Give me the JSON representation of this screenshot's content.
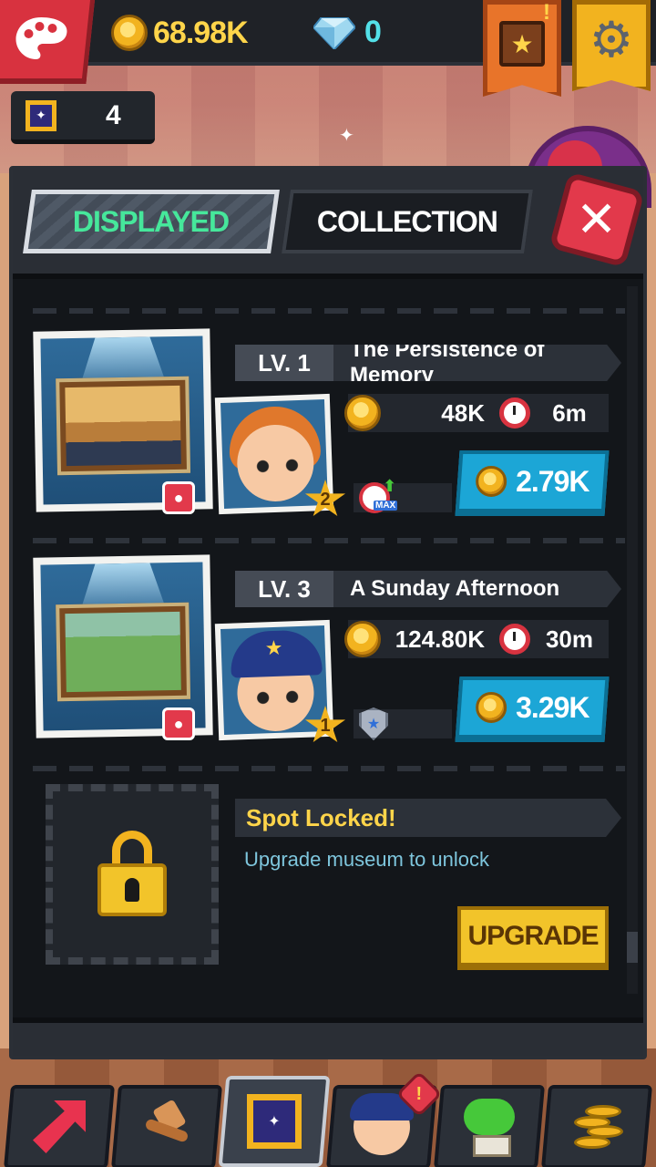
{
  "hud": {
    "coins": "68.98K",
    "gems": "0",
    "frames": "4",
    "icons": [
      "palette-icon",
      "coin-icon",
      "diamond-icon",
      "star-book-icon",
      "gear-icon",
      "frame-icon"
    ]
  },
  "tabs": {
    "displayed": "DISPLAYED",
    "collection": "COLLECTION",
    "active": "displayed"
  },
  "paintings": [
    {
      "level": "LV. 1",
      "name": "The Persistence of Memory",
      "income": "48K",
      "time": "6m",
      "worker_rank": "2",
      "speed_label": "MAX",
      "upgrade_cost": "2.79K"
    },
    {
      "level": "LV. 3",
      "name": "A Sunday Afternoon",
      "income": "124.80K",
      "time": "30m",
      "worker_rank": "1",
      "upgrade_cost": "3.29K"
    }
  ],
  "locked_slot": {
    "title": "Spot Locked!",
    "description": "Upgrade museum to unlock",
    "button": "UPGRADE"
  },
  "bottom_nav": {
    "items": [
      "arrow-icon",
      "hammer-icon",
      "frame-icon",
      "police-worker-icon",
      "tree-icon",
      "coins-icon"
    ],
    "active": 2,
    "alert": "!"
  },
  "colors": {
    "coin": "#f2b31f",
    "gem": "#53e0e8",
    "tab_active_text": "#46e79b",
    "upgrade_blue": "#1ca6d6",
    "upgrade_yellow": "#f2c42a",
    "close_red": "#e2394b"
  }
}
